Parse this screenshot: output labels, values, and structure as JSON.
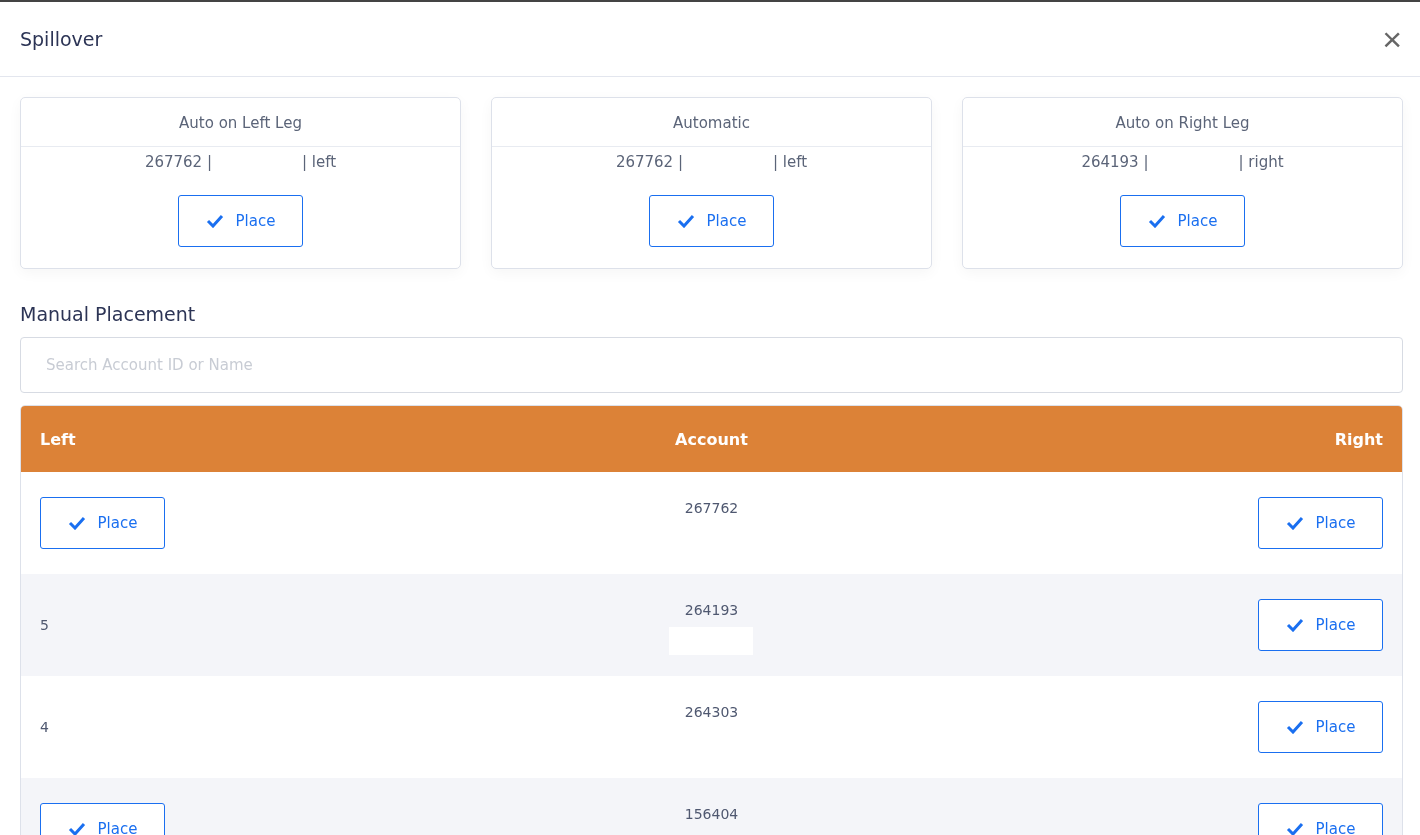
{
  "modal": {
    "title": "Spillover",
    "close": "×"
  },
  "options": [
    {
      "title": "Auto on Left Leg",
      "account": "267762 |",
      "leg": "| left",
      "button": "Place"
    },
    {
      "title": "Automatic",
      "account": "267762 |",
      "leg": "| left",
      "button": "Place"
    },
    {
      "title": "Auto on Right Leg",
      "account": "264193 |",
      "leg": "| right",
      "button": "Place"
    }
  ],
  "manual": {
    "heading": "Manual Placement",
    "search": {
      "placeholder": "Search Account ID or Name"
    }
  },
  "table": {
    "columns": [
      "Left",
      "Account",
      "Right"
    ],
    "rows": [
      {
        "left": {
          "kind": "button",
          "label": "Place"
        },
        "account": "267762",
        "redacted": false,
        "right": {
          "kind": "button",
          "label": "Place"
        }
      },
      {
        "left": {
          "kind": "text",
          "text": "5"
        },
        "account": "264193",
        "redacted": true,
        "right": {
          "kind": "button",
          "label": "Place"
        }
      },
      {
        "left": {
          "kind": "text",
          "text": "4"
        },
        "account": "264303",
        "redacted": false,
        "right": {
          "kind": "button",
          "label": "Place"
        }
      },
      {
        "left": {
          "kind": "button",
          "label": "Place"
        },
        "account": "156404",
        "redacted": false,
        "right": {
          "kind": "button",
          "label": "Place"
        }
      }
    ]
  }
}
